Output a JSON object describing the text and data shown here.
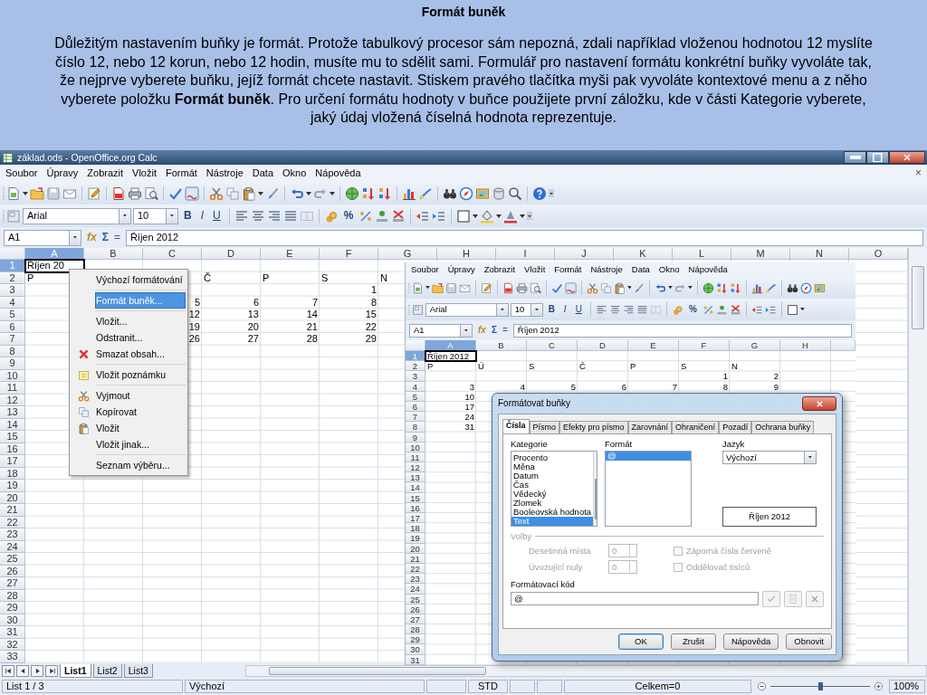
{
  "slide": {
    "title": "Formát buněk",
    "text": "Důležitým nastavením buňky je formát. Protože tabulkový procesor sám nepozná, zdali například vloženou hodnotou 12 myslíte číslo 12, nebo 12 korun, nebo 12 hodin, musíte mu to sdělit sami. Formulář pro nastavení formátu konkrétní buňky vyvoláte tak, že nejprve vyberete buňku, jejíž formát chcete nastavit. Stiskem pravého tlačítka myši pak vyvoláte kontextové menu a z něho vyberete položku **Formát buněk**. Pro určení formátu hodnoty v buňce použijete první záložku, kde v části Kategorie vyberete, jaký údaj vložená číselná hodnota reprezentuje."
  },
  "window": {
    "title": "základ.ods - OpenOffice.org Calc"
  },
  "menu": {
    "items": [
      "Soubor",
      "Úpravy",
      "Zobrazit",
      "Vložit",
      "Formát",
      "Nástroje",
      "Data",
      "Okno",
      "Nápověda"
    ],
    "close": "×"
  },
  "toolbar": {
    "font": "Arial",
    "size": "10",
    "style_buttons": [
      "B",
      "I",
      "U"
    ],
    "percent": "%"
  },
  "formula_bar": {
    "cell": "A1",
    "function_wizard": "fx",
    "sum": "Σ",
    "equals": "=",
    "content": "Říjen 2012"
  },
  "sheet": {
    "columns": [
      {
        "label": "A",
        "selected": true
      },
      {
        "label": "B",
        "selected": false
      },
      {
        "label": "C",
        "selected": false
      },
      {
        "label": "D",
        "selected": false
      },
      {
        "label": "E",
        "selected": false
      },
      {
        "label": "F",
        "selected": false
      },
      {
        "label": "G",
        "selected": false
      },
      {
        "label": "H",
        "selected": false
      },
      {
        "label": "I",
        "selected": false
      },
      {
        "label": "J",
        "selected": false
      },
      {
        "label": "K",
        "selected": false
      },
      {
        "label": "L",
        "selected": false
      },
      {
        "label": "M",
        "selected": false
      },
      {
        "label": "N",
        "selected": false
      },
      {
        "label": "O",
        "selected": false
      }
    ],
    "rows": [
      {
        "label": "1",
        "selected": true,
        "cells": [
          {
            "kind": "text",
            "value": "Říjen 20",
            "active": true
          }
        ]
      },
      {
        "label": "2",
        "selected": false,
        "cells": [
          {
            "kind": "text",
            "value": "P",
            "active": false
          },
          {
            "kind": "empty"
          },
          {
            "kind": "empty"
          },
          {
            "kind": "text",
            "value": "Č",
            "active": false
          },
          {
            "kind": "text",
            "value": "P",
            "active": false
          },
          {
            "kind": "text",
            "value": "S",
            "active": false
          },
          {
            "kind": "text",
            "value": "N",
            "active": false
          }
        ]
      },
      {
        "label": "3",
        "selected": false,
        "cells": [
          {
            "kind": "empty"
          },
          {
            "kind": "empty"
          },
          {
            "kind": "empty"
          },
          {
            "kind": "empty"
          },
          {
            "kind": "empty"
          },
          {
            "kind": "number",
            "value": "1",
            "active": false
          }
        ]
      },
      {
        "label": "4",
        "selected": false,
        "cells": [
          {
            "kind": "empty"
          },
          {
            "kind": "empty"
          },
          {
            "kind": "number",
            "value": "5",
            "active": false
          },
          {
            "kind": "number",
            "value": "6",
            "active": false
          },
          {
            "kind": "number",
            "value": "7",
            "active": false
          },
          {
            "kind": "number",
            "value": "8",
            "active": false
          }
        ]
      },
      {
        "label": "5",
        "selected": false,
        "cells": [
          {
            "kind": "empty"
          },
          {
            "kind": "empty"
          },
          {
            "kind": "number",
            "value": "12",
            "active": false
          },
          {
            "kind": "number",
            "value": "13",
            "active": false
          },
          {
            "kind": "number",
            "value": "14",
            "active": false
          },
          {
            "kind": "number",
            "value": "15",
            "active": false
          }
        ]
      },
      {
        "label": "6",
        "selected": false,
        "cells": [
          {
            "kind": "empty"
          },
          {
            "kind": "empty"
          },
          {
            "kind": "number",
            "value": "19",
            "active": false
          },
          {
            "kind": "number",
            "value": "20",
            "active": false
          },
          {
            "kind": "number",
            "value": "21",
            "active": false
          },
          {
            "kind": "number",
            "value": "22",
            "active": false
          }
        ]
      },
      {
        "label": "7",
        "selected": false,
        "cells": [
          {
            "kind": "empty"
          },
          {
            "kind": "empty"
          },
          {
            "kind": "number",
            "value": "26",
            "active": false
          },
          {
            "kind": "number",
            "value": "27",
            "active": false
          },
          {
            "kind": "number",
            "value": "28",
            "active": false
          },
          {
            "kind": "number",
            "value": "29",
            "active": false
          }
        ]
      },
      {
        "label": "8",
        "selected": false
      },
      {
        "label": "9",
        "selected": false
      },
      {
        "label": "10",
        "selected": false
      },
      {
        "label": "11",
        "selected": false
      },
      {
        "label": "12",
        "selected": false
      },
      {
        "label": "13",
        "selected": false
      },
      {
        "label": "14",
        "selected": false
      },
      {
        "label": "15",
        "selected": false
      },
      {
        "label": "16",
        "selected": false
      },
      {
        "label": "17",
        "selected": false
      },
      {
        "label": "18",
        "selected": false
      },
      {
        "label": "19",
        "selected": false
      },
      {
        "label": "20",
        "selected": false
      },
      {
        "label": "21",
        "selected": false
      },
      {
        "label": "22",
        "selected": false
      },
      {
        "label": "23",
        "selected": false
      },
      {
        "label": "24",
        "selected": false
      },
      {
        "label": "25",
        "selected": false
      },
      {
        "label": "26",
        "selected": false
      },
      {
        "label": "27",
        "selected": false
      },
      {
        "label": "28",
        "selected": false
      },
      {
        "label": "29",
        "selected": false
      },
      {
        "label": "30",
        "selected": false
      },
      {
        "label": "31",
        "selected": false
      },
      {
        "label": "32",
        "selected": false
      },
      {
        "label": "33",
        "selected": false
      }
    ]
  },
  "context_menu": {
    "items": [
      {
        "kind": "item",
        "label": "Výchozí formátování",
        "selected": false
      },
      {
        "kind": "separator"
      },
      {
        "kind": "item",
        "label": "Formát buněk...",
        "selected": true
      },
      {
        "kind": "separator"
      },
      {
        "kind": "item",
        "label": "Vložit...",
        "selected": false
      },
      {
        "kind": "item",
        "label": "Odstranit...",
        "selected": false
      },
      {
        "kind": "item",
        "label": "Smazat obsah...",
        "selected": false
      },
      {
        "kind": "separator"
      },
      {
        "kind": "item",
        "label": "Vložit poznámku",
        "selected": false
      },
      {
        "kind": "separator"
      },
      {
        "kind": "item",
        "label": "Vyjmout",
        "selected": false
      },
      {
        "kind": "item",
        "label": "Kopírovat",
        "selected": false
      },
      {
        "kind": "item",
        "label": "Vložit",
        "selected": false
      },
      {
        "kind": "item",
        "label": "Vložit jinak...",
        "selected": false
      },
      {
        "kind": "separator"
      },
      {
        "kind": "item",
        "label": "Seznam výběru...",
        "selected": false
      }
    ]
  },
  "sheet_tabs": [
    {
      "label": "List1",
      "selected": true
    },
    {
      "label": "List2",
      "selected": false
    },
    {
      "label": "List3",
      "selected": false
    }
  ],
  "status_bar": {
    "sheet": "List 1 / 3",
    "style": "Výchozí",
    "mode": "STD",
    "sum": "Celkem=0",
    "zoom_slider": {
      "level": 0.5
    },
    "zoom": "100%"
  },
  "inner_window": {
    "menu": [
      "Soubor",
      "Úpravy",
      "Zobrazit",
      "Vložit",
      "Formát",
      "Nástroje",
      "Data",
      "Okno",
      "Nápověda"
    ],
    "toolbar": {
      "font": "Arial",
      "size": "10",
      "style_buttons": [
        "B",
        "I",
        "U"
      ],
      "percent": "%"
    },
    "formula_bar": {
      "cell": "A1",
      "function_wizard": "fx",
      "sum": "Σ",
      "equals": "=",
      "content": "Říjen 2012"
    },
    "sheet": {
      "columns": [
        {
          "label": "A",
          "selected": true
        },
        {
          "label": "B",
          "selected": false
        },
        {
          "label": "C",
          "selected": false
        },
        {
          "label": "D",
          "selected": false
        },
        {
          "label": "E",
          "selected": false
        },
        {
          "label": "F",
          "selected": false
        },
        {
          "label": "G",
          "selected": false
        },
        {
          "label": "H",
          "selected": false
        }
      ],
      "rows": [
        {
          "label": "1",
          "selected": true,
          "cells": [
            {
              "kind": "text",
              "value": "Říjen 2012",
              "active": true
            }
          ]
        },
        {
          "label": "2",
          "selected": false,
          "cells": [
            {
              "kind": "text",
              "value": "P",
              "active": false
            },
            {
              "kind": "text",
              "value": "Ú",
              "active": false
            },
            {
              "kind": "text",
              "value": "S",
              "active": false
            },
            {
              "kind": "text",
              "value": "Č",
              "active": false
            },
            {
              "kind": "text",
              "value": "P",
              "active": false
            },
            {
              "kind": "text",
              "value": "S",
              "active": false
            },
            {
              "kind": "text",
              "value": "N",
              "active": false
            }
          ]
        },
        {
          "label": "3",
          "selected": false,
          "cells": [
            {
              "kind": "empty"
            },
            {
              "kind": "empty"
            },
            {
              "kind": "empty"
            },
            {
              "kind": "empty"
            },
            {
              "kind": "empty"
            },
            {
              "kind": "number",
              "value": "1",
              "active": false
            },
            {
              "kind": "number",
              "value": "2",
              "active": false
            }
          ]
        },
        {
          "label": "4",
          "selected": false,
          "cells": [
            {
              "kind": "number",
              "value": "3",
              "active": false
            },
            {
              "kind": "number",
              "value": "4",
              "active": false
            },
            {
              "kind": "number",
              "value": "5",
              "active": false
            },
            {
              "kind": "number",
              "value": "6",
              "active": false
            },
            {
              "kind": "number",
              "value": "7",
              "active": false
            },
            {
              "kind": "number",
              "value": "8",
              "active": false
            },
            {
              "kind": "number",
              "value": "9",
              "active": false
            }
          ]
        },
        {
          "label": "5",
          "selected": false,
          "cells": [
            {
              "kind": "number",
              "value": "10",
              "active": false
            }
          ]
        },
        {
          "label": "6",
          "selected": false,
          "cells": [
            {
              "kind": "number",
              "value": "17",
              "active": false
            }
          ]
        },
        {
          "label": "7",
          "selected": false,
          "cells": [
            {
              "kind": "number",
              "value": "24",
              "active": false
            }
          ]
        },
        {
          "label": "8",
          "selected": false,
          "cells": [
            {
              "kind": "number",
              "value": "31",
              "active": false
            }
          ]
        },
        {
          "label": "9",
          "selected": false
        },
        {
          "label": "10",
          "selected": false
        },
        {
          "label": "11",
          "selected": false
        },
        {
          "label": "12",
          "selected": false
        },
        {
          "label": "13",
          "selected": false
        },
        {
          "label": "14",
          "selected": false
        },
        {
          "label": "15",
          "selected": false
        },
        {
          "label": "16",
          "selected": false
        },
        {
          "label": "17",
          "selected": false
        },
        {
          "label": "18",
          "selected": false
        },
        {
          "label": "19",
          "selected": false
        },
        {
          "label": "20",
          "selected": false
        },
        {
          "label": "21",
          "selected": false
        },
        {
          "label": "22",
          "selected": false
        },
        {
          "label": "23",
          "selected": false
        },
        {
          "label": "24",
          "selected": false
        },
        {
          "label": "25",
          "selected": false
        },
        {
          "label": "26",
          "selected": false
        },
        {
          "label": "27",
          "selected": false
        },
        {
          "label": "28",
          "selected": false
        },
        {
          "label": "29",
          "selected": false
        },
        {
          "label": "30",
          "selected": false
        },
        {
          "label": "31",
          "selected": false
        }
      ]
    }
  },
  "dialog": {
    "title": "Formátovat buňky",
    "tabs": [
      {
        "label": "Čísla",
        "selected": true
      },
      {
        "label": "Písmo",
        "selected": false
      },
      {
        "label": "Efekty pro písmo",
        "selected": false
      },
      {
        "label": "Zarovnání",
        "selected": false
      },
      {
        "label": "Ohraničení",
        "selected": false
      },
      {
        "label": "Pozadí",
        "selected": false
      },
      {
        "label": "Ochrana buňky",
        "selected": false
      }
    ],
    "category": {
      "label": "Kategorie",
      "items": [
        {
          "label": "Procento",
          "selected": false
        },
        {
          "label": "Měna",
          "selected": false
        },
        {
          "label": "Datum",
          "selected": false
        },
        {
          "label": "Čas",
          "selected": false
        },
        {
          "label": "Vědecký",
          "selected": false
        },
        {
          "label": "Zlomek",
          "selected": false
        },
        {
          "label": "Booleovská hodnota",
          "selected": false
        },
        {
          "label": "Text",
          "selected": true
        }
      ]
    },
    "format": {
      "label": "Formát",
      "items": [
        {
          "label": "@",
          "selected": true
        }
      ]
    },
    "language": {
      "label": "Jazyk",
      "value": "Výchozí"
    },
    "preview": "Říjen 2012",
    "options": {
      "label": "Volby",
      "disabled": true,
      "fields": [
        {
          "label": "Desetinná místa",
          "value": "0"
        },
        {
          "label": "Úvozující nuly",
          "value": "0"
        }
      ],
      "checkboxes": [
        {
          "label": "Záporná čísla červeně",
          "checked": false
        },
        {
          "label": "Oddělovač tisíců",
          "checked": false
        }
      ]
    },
    "format_code": {
      "label": "Formátovací kód",
      "value": "@"
    },
    "buttons": [
      {
        "label": "OK",
        "default": true
      },
      {
        "label": "Zrušit",
        "default": false
      },
      {
        "label": "Nápověda",
        "default": false
      },
      {
        "label": "Obnovit",
        "default": false
      }
    ]
  }
}
